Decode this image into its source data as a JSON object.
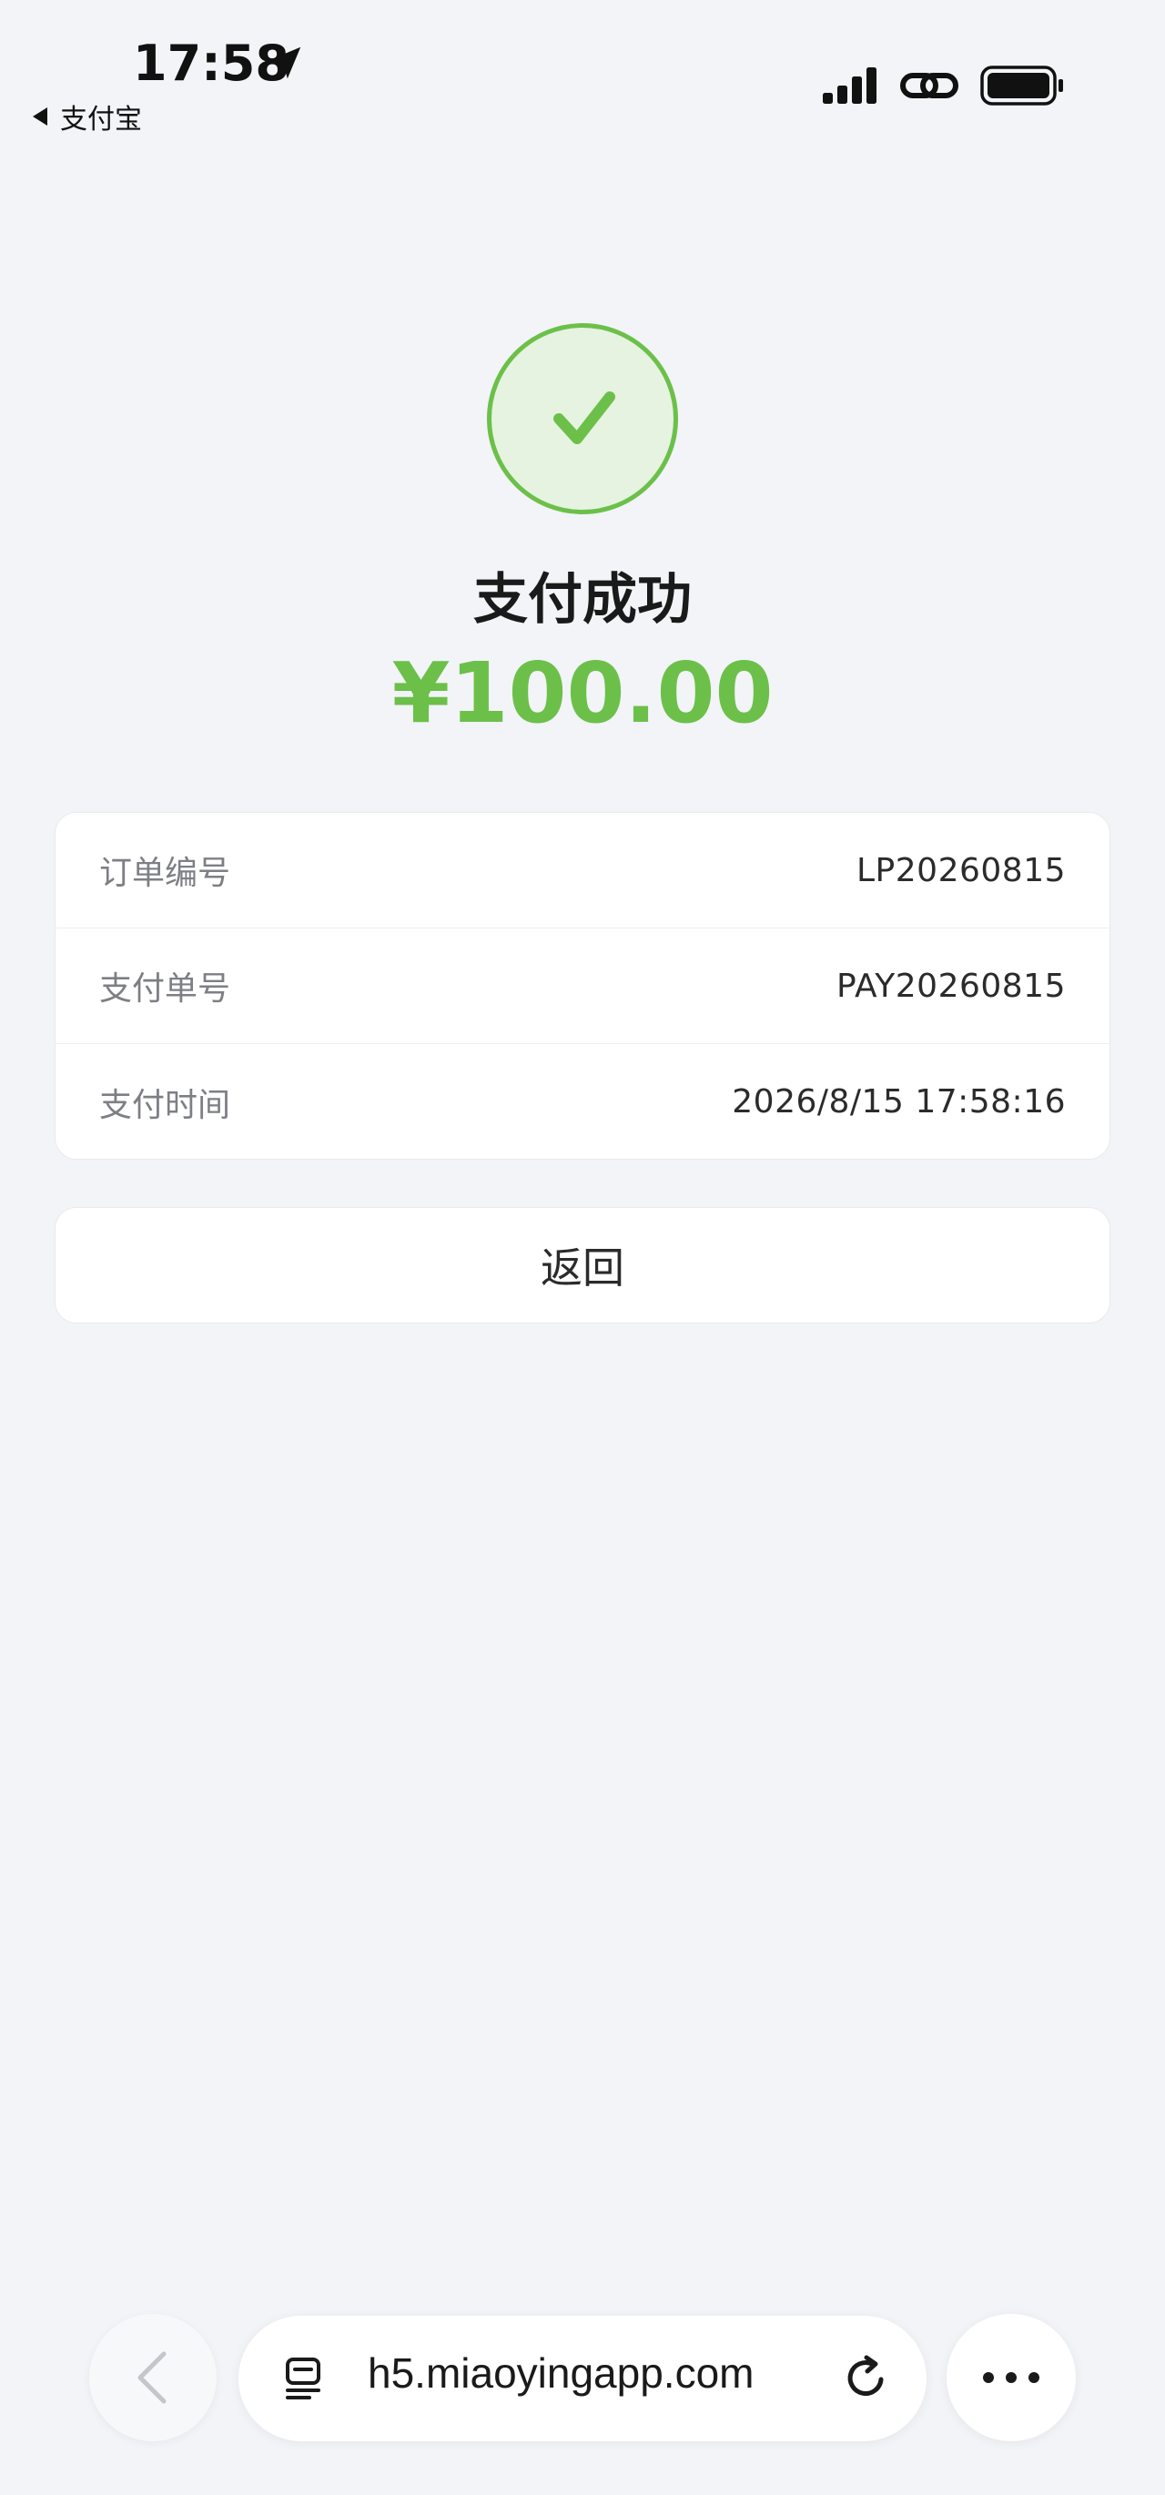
{
  "status_bar": {
    "time": "17:58",
    "back_app_label": "支付宝"
  },
  "result": {
    "title": "支付成功",
    "amount": "¥100.00",
    "accent_color": "#6cc04a"
  },
  "details": [
    {
      "label": "订单编号",
      "value": "LP20260815"
    },
    {
      "label": "支付单号",
      "value": "PAY20260815"
    },
    {
      "label": "支付时间",
      "value": "2026/8/15 17:58:16"
    }
  ],
  "actions": {
    "back_label": "返回"
  },
  "browser": {
    "url": "h5.miaoyingapp.com"
  },
  "icons": {
    "location": "location-arrow-icon",
    "signal": "cellular-signal-icon",
    "link": "link-icon",
    "battery": "battery-icon",
    "success": "checkmark-icon",
    "nav_back": "chevron-left-icon",
    "tabs": "tabs-icon",
    "reload": "reload-icon",
    "more": "more-icon"
  }
}
